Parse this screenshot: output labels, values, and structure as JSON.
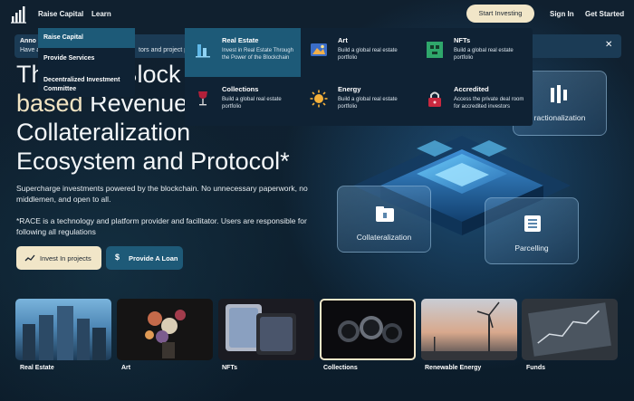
{
  "nav": {
    "links": [
      "Raise Capital",
      "Learn"
    ],
    "start_label": "Start Investing",
    "signin_label": "Sign In",
    "getstarted_label": "Get Started"
  },
  "announcement": {
    "title": "Anno",
    "text": "Have a",
    "text_tail": "tors and project p"
  },
  "raise_menu": {
    "items": [
      "Raise Capital",
      "Provide Services",
      "Decentralized Investment",
      "Committee"
    ]
  },
  "mega_menu": {
    "items": [
      {
        "title": "Real Estate",
        "desc": "Invest in Real Estate Through the Power of the Blockchain",
        "icon": "building-icon"
      },
      {
        "title": "Art",
        "desc": "Build a global real estate portfolio",
        "icon": "painting-icon"
      },
      {
        "title": "NFTs",
        "desc": "Build a global real estate portfolio",
        "icon": "pixel-icon"
      },
      {
        "title": "Collections",
        "desc": "Build a global real estate portfolio",
        "icon": "wine-icon"
      },
      {
        "title": "Energy",
        "desc": "Build a global real estate portfolio",
        "icon": "sun-icon"
      },
      {
        "title": "Accredited",
        "desc": "Access the private deal room for accredited investors",
        "icon": "lock-icon"
      }
    ]
  },
  "hero": {
    "line1_start": "Th",
    "line1_end": "Block",
    "line2_gold": "based",
    "line2_rest": "Revenue",
    "line3": "Collateralization",
    "line4": "Ecosystem and Protocol*",
    "desc": "Supercharge investments powered by the blockchain. No unnecessary paperwork, no middlemen, and open to all.",
    "note": "*RACE is a technology and platform provider and facilitator. Users are responsible for following all regulations",
    "invest_label": "Invest In projects",
    "loan_label": "Provide A Loan"
  },
  "visual": {
    "cards": [
      "ractionalization",
      "Collateralization",
      "Parcelling"
    ]
  },
  "categories": [
    "Real Estate",
    "Art",
    "NFTs",
    "Collections",
    "Renewable Energy",
    "Funds"
  ],
  "colors": {
    "accent_gold": "#f1e6c8",
    "accent_teal": "#1e5a78",
    "menu_bg": "#0f2234"
  }
}
